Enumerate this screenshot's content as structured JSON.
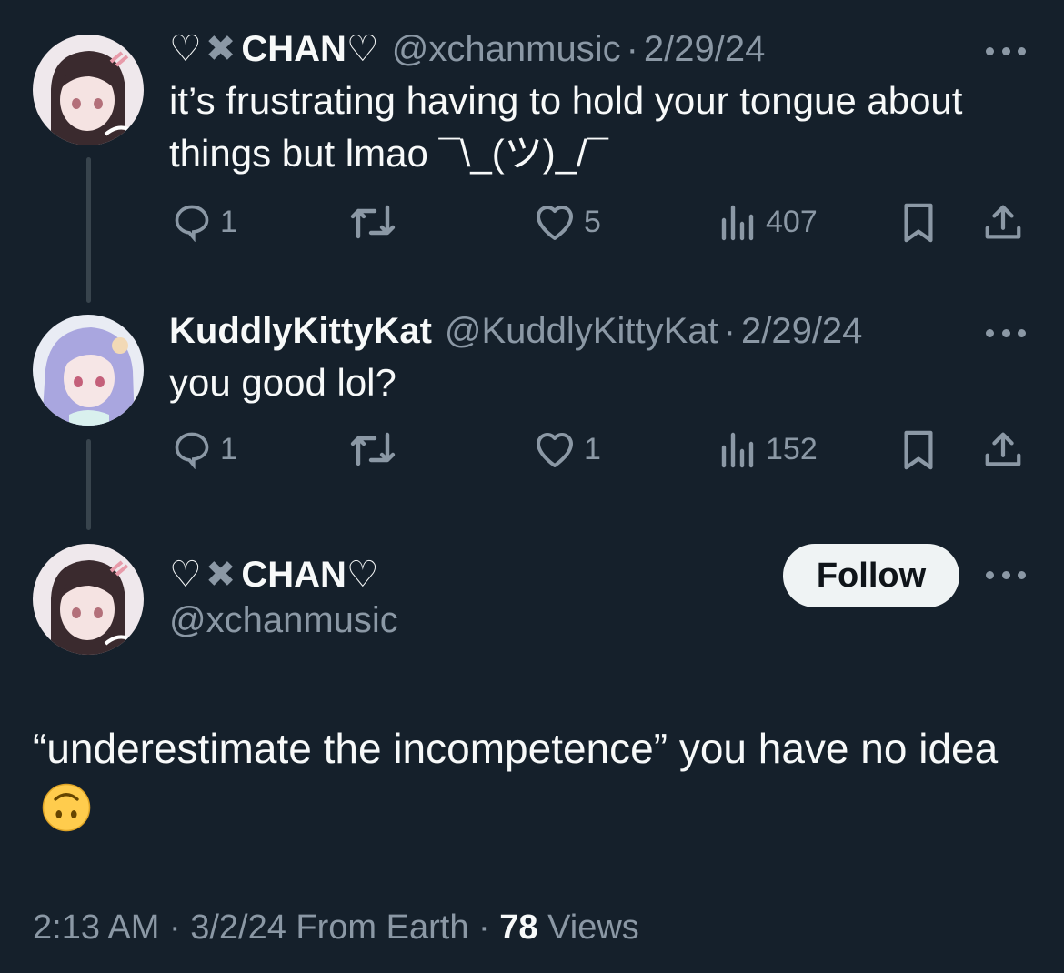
{
  "tweets": [
    {
      "heart_prefix": "♡",
      "x_mark": "✖",
      "name": "CHAN",
      "heart_suffix": "♡",
      "handle": "@xchanmusic",
      "separator": "·",
      "date": "2/29/24",
      "text": "it’s frustrating having to hold your tongue about things but lmao ¯\\_(ツ)_/¯",
      "replies": "1",
      "retweets": "",
      "likes": "5",
      "views": "407"
    },
    {
      "name": "KuddlyKittyKat",
      "handle": "@KuddlyKittyKat",
      "separator": "·",
      "date": "2/29/24",
      "text": "you good lol?",
      "replies": "1",
      "retweets": "",
      "likes": "1",
      "views": "152"
    }
  ],
  "main_tweet": {
    "heart_prefix": "♡",
    "x_mark": "✖",
    "name": "CHAN",
    "heart_suffix": "♡",
    "handle": "@xchanmusic",
    "follow_label": "Follow",
    "text": "“underestimate the incompetence” you have no idea",
    "emoji": "upside-down-face",
    "time": "2:13 AM",
    "separator": "·",
    "date": "3/2/24",
    "source": "From Earth",
    "views_count": "78",
    "views_label": "Views"
  },
  "colors": {
    "background": "#15202b",
    "text": "#f7f9f9",
    "muted": "#8b98a5",
    "thread_line": "#38444d",
    "follow_bg": "#eff3f4"
  },
  "icons": [
    "reply-icon",
    "retweet-icon",
    "like-icon",
    "views-icon",
    "bookmark-icon",
    "share-icon",
    "more-icon"
  ]
}
